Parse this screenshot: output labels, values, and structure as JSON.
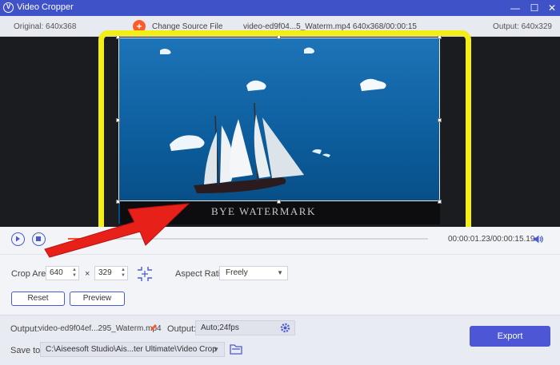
{
  "window": {
    "title": "Video Cropper",
    "controls": [
      "—",
      "☐",
      "✕"
    ]
  },
  "info": {
    "original": "Original: 640x368",
    "source_button": "Change Source File",
    "file": "video-ed9f04...5_Waterm.mp4    640x368/00:00:15",
    "output": "Output: 640x329"
  },
  "preview": {
    "watermark_text": "BYE WATERMARK"
  },
  "playback": {
    "timecode": "00:00:01.23/00:00:15.19",
    "progress": 0.08
  },
  "crop": {
    "area_label": "Crop Area:",
    "width": "640",
    "times": "×",
    "height": "329",
    "aspect_label": "Aspect Ratio:",
    "aspect_value": "Freely",
    "reset_label": "Reset",
    "preview_label": "Preview"
  },
  "output": {
    "label": "Output:",
    "filename": "video-ed9f04ef...295_Waterm.mp4",
    "settings_label": "Output:",
    "settings_value": "Auto;24fps",
    "saveto_label": "Save to:",
    "path": "C:\\Aiseesoft Studio\\Ais...ter Ultimate\\Video Crop",
    "export_label": "Export"
  },
  "colors": {
    "accent": "#4d57d6",
    "highlight": "#f3ee16",
    "arrow": "#e8201a"
  }
}
